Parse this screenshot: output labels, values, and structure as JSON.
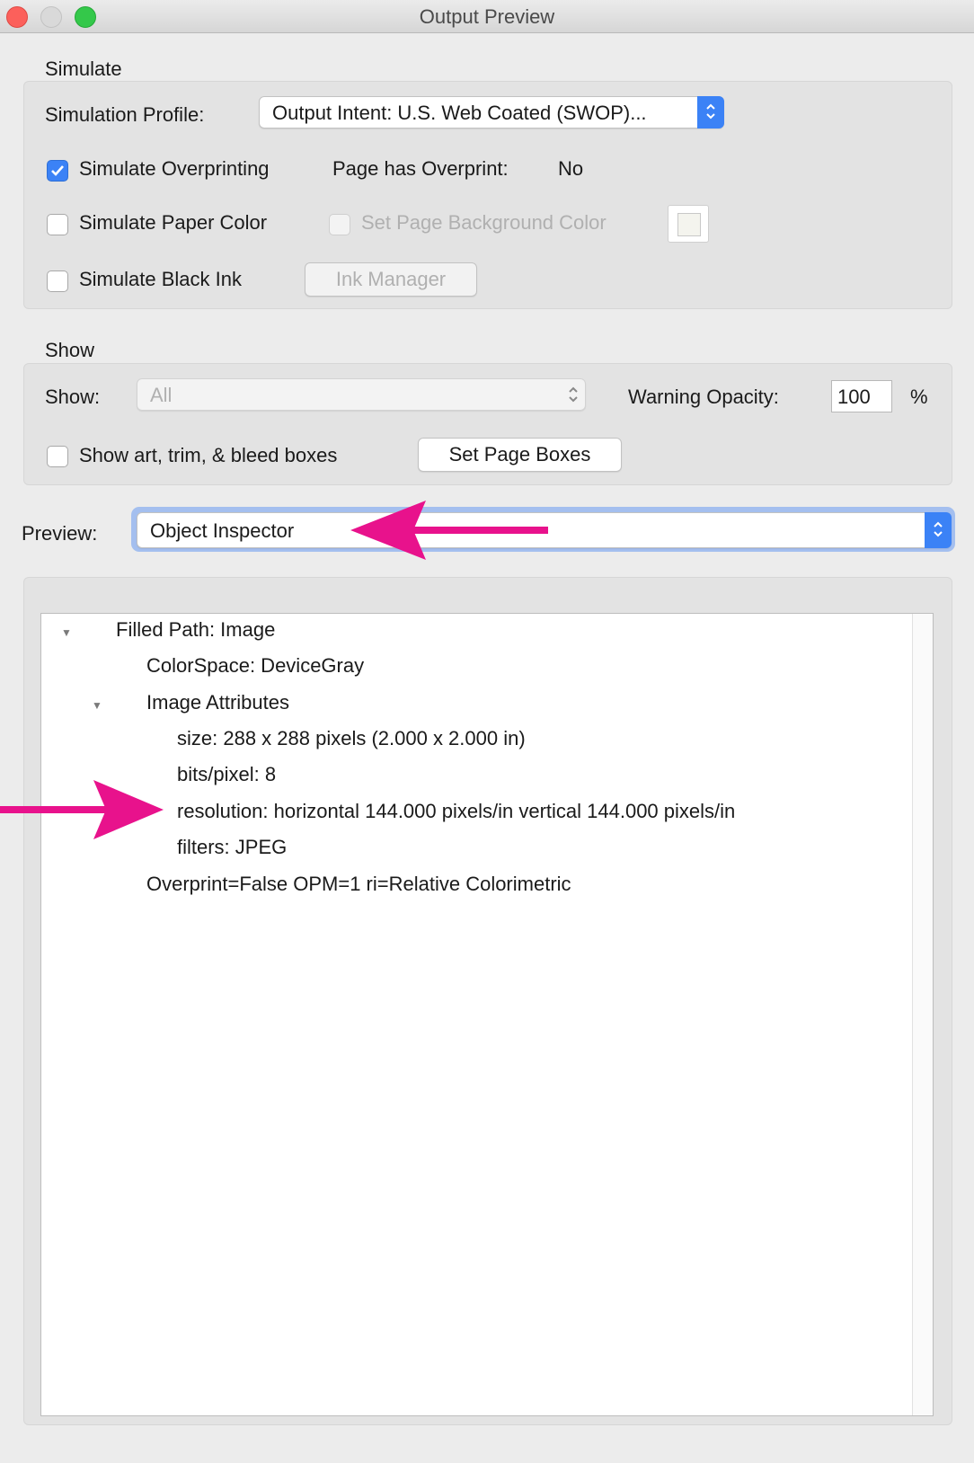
{
  "window": {
    "title": "Output Preview"
  },
  "simulate": {
    "section_title": "Simulate",
    "profile_label": "Simulation Profile:",
    "profile_value": "Output Intent: U.S. Web Coated (SWOP)...",
    "overprinting_label": "Simulate Overprinting",
    "overprinting_checked": true,
    "page_overprint_label": "Page has Overprint:",
    "page_overprint_value": "No",
    "paper_color_label": "Simulate Paper Color",
    "paper_color_checked": false,
    "page_bg_label": "Set Page Background Color",
    "black_ink_label": "Simulate Black Ink",
    "black_ink_checked": false,
    "ink_manager_label": "Ink Manager"
  },
  "show": {
    "section_title": "Show",
    "show_label": "Show:",
    "show_value": "All",
    "warning_opacity_label": "Warning Opacity:",
    "warning_opacity_value": "100",
    "percent_label": "%",
    "boxes_label": "Show art, trim, & bleed boxes",
    "boxes_checked": false,
    "set_page_boxes_label": "Set Page Boxes"
  },
  "preview": {
    "label": "Preview:",
    "value": "Object Inspector"
  },
  "inspector": {
    "rows": [
      {
        "text": "Filled Path: Image",
        "expanded": true
      },
      {
        "text": "ColorSpace: DeviceGray"
      },
      {
        "text": "Image Attributes",
        "expanded": true
      },
      {
        "text": "size: 288 x 288 pixels (2.000 x 2.000 in)"
      },
      {
        "text": "bits/pixel: 8"
      },
      {
        "text": "resolution: horizontal 144.000 pixels/in vertical 144.000 pixels/in"
      },
      {
        "text": "filters: JPEG"
      },
      {
        "text": "Overprint=False OPM=1 ri=Relative Colorimetric"
      }
    ]
  },
  "colors": {
    "accent": "#3b82f6",
    "arrow": "#e8128c"
  }
}
